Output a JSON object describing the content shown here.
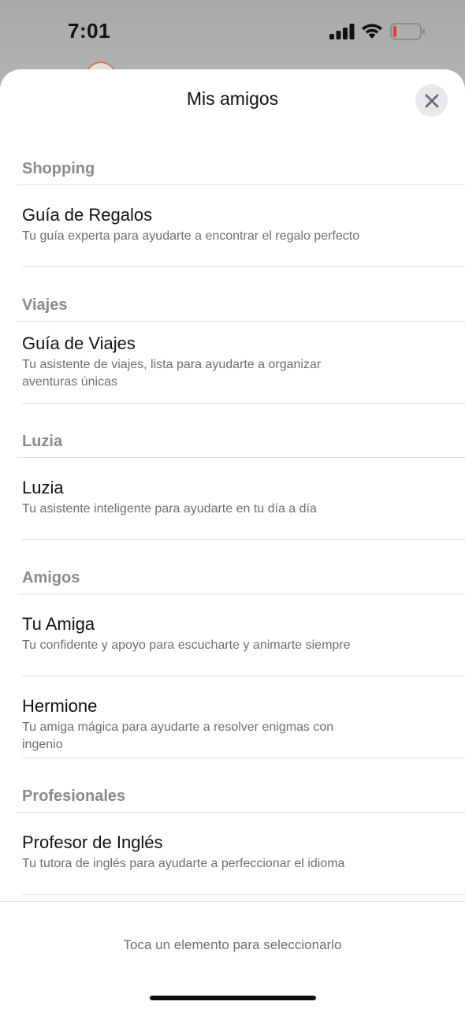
{
  "status_bar": {
    "time": "7:01",
    "icons": [
      "signal-icon",
      "wifi-icon",
      "battery-low-icon"
    ],
    "battery_color": "#e53935"
  },
  "sheet": {
    "title": "Mis amigos",
    "close_icon": "close-icon"
  },
  "sections": [
    {
      "header": "Shopping",
      "items": [
        {
          "title": "Guía de Regalos",
          "desc": "Tu guía experta para ayudarte a encontrar el regalo perfecto"
        }
      ]
    },
    {
      "header": "Viajes",
      "items": [
        {
          "title": "Guía de Viajes",
          "desc": "Tu asistente de viajes, lista para ayudarte a organizar aventuras únicas"
        }
      ]
    },
    {
      "header": "Luzia",
      "items": [
        {
          "title": "Luzia",
          "desc": "Tu asistente inteligente para ayudarte en tu día a día"
        }
      ]
    },
    {
      "header": "Amigos",
      "items": [
        {
          "title": "Tu Amiga",
          "desc": "Tu confidente y apoyo para escucharte y animarte siempre"
        },
        {
          "title": "Hermione",
          "desc": "Tu amiga mágica para ayudarte a resolver enigmas con ingenio"
        }
      ]
    },
    {
      "header": "Profesionales",
      "items": [
        {
          "title": "Profesor de Inglés",
          "desc": "Tu tutora de inglés para ayudarte a perfeccionar el idioma"
        }
      ]
    }
  ],
  "footer": {
    "hint": "Toca un elemento para seleccionarlo"
  }
}
